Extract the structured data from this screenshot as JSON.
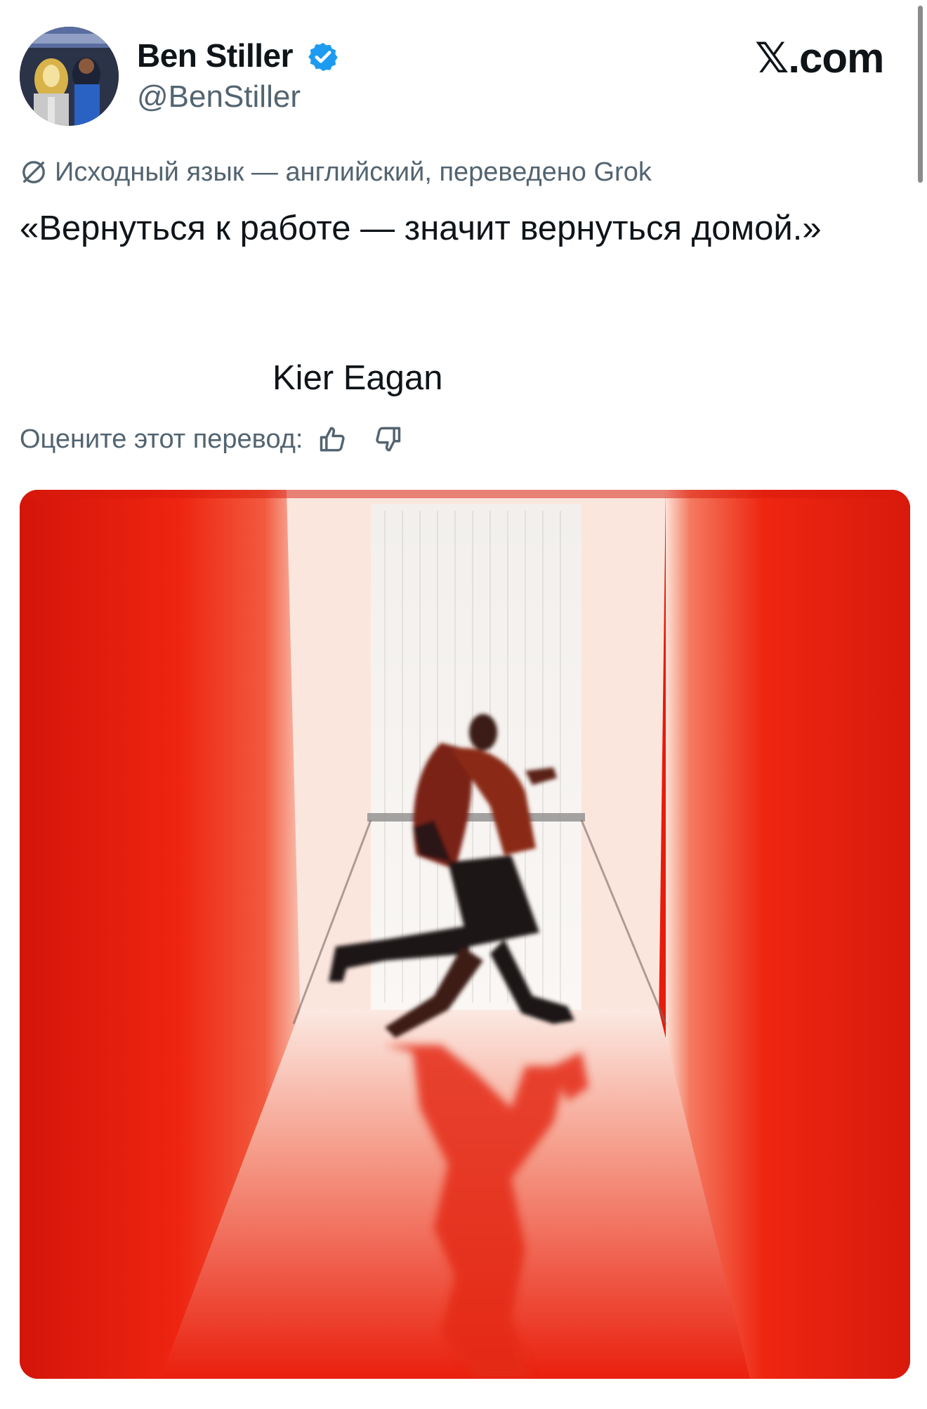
{
  "author": {
    "name": "Ben Stiller",
    "handle": "@BenStiller",
    "verified": true,
    "avatar_icon": "avatar-photo"
  },
  "brand": {
    "label": "𝕏.com"
  },
  "translation": {
    "note": "Исходный язык — английский, переведено Grok",
    "icon": "globe-slash-icon"
  },
  "tweet": {
    "text": "«Вернуться к работе — значит вернуться домой.»",
    "signature": "Kier Eagan"
  },
  "rating": {
    "label": "Оцените этот перевод:",
    "up_icon": "thumbs-up-icon",
    "down_icon": "thumbs-down-icon"
  },
  "colors": {
    "verified": "#1d9bf0",
    "secondary_text": "#536471",
    "primary_text": "#0f1419",
    "media_red": "#e61c0c"
  }
}
